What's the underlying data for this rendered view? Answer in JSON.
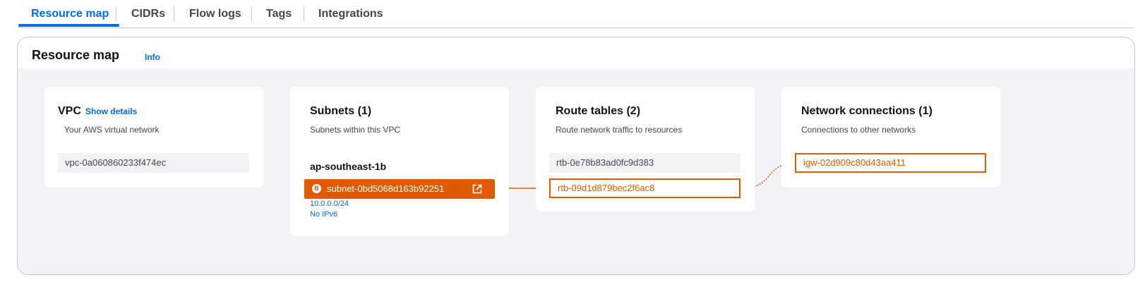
{
  "tabs": [
    {
      "label": "Resource map",
      "active": true
    },
    {
      "label": "CIDRs"
    },
    {
      "label": "Flow logs"
    },
    {
      "label": "Tags"
    },
    {
      "label": "Integrations"
    }
  ],
  "resource_map": {
    "title": "Resource map",
    "info_label": "Info"
  },
  "vpc": {
    "title": "VPC",
    "show_details": "Show details",
    "subtitle": "Your AWS virtual network",
    "id": "vpc-0a060860233f474ec"
  },
  "subnets": {
    "title": "Subnets (1)",
    "subtitle": "Subnets within this VPC",
    "az": "ap-southeast-1b",
    "badge": "B",
    "subnet_id": "subnet-0bd5068d163b92251",
    "cidr": "10.0.0.0/24",
    "ipv6": "No IPv6"
  },
  "route_tables": {
    "title": "Route tables (2)",
    "subtitle": "Route network traffic to resources",
    "items": [
      "rtb-0e78b83ad0fc9d383",
      "rtb-09d1d879bec2f6ac8"
    ]
  },
  "network_connections": {
    "title": "Network connections (1)",
    "subtitle": "Connections to other networks",
    "items": [
      "igw-02d909c80d43aa411"
    ]
  },
  "colors": {
    "accent": "#006ce0",
    "highlight": "#e05a00",
    "background": "#f3f3f7"
  },
  "icons": [
    "external-link-icon"
  ]
}
